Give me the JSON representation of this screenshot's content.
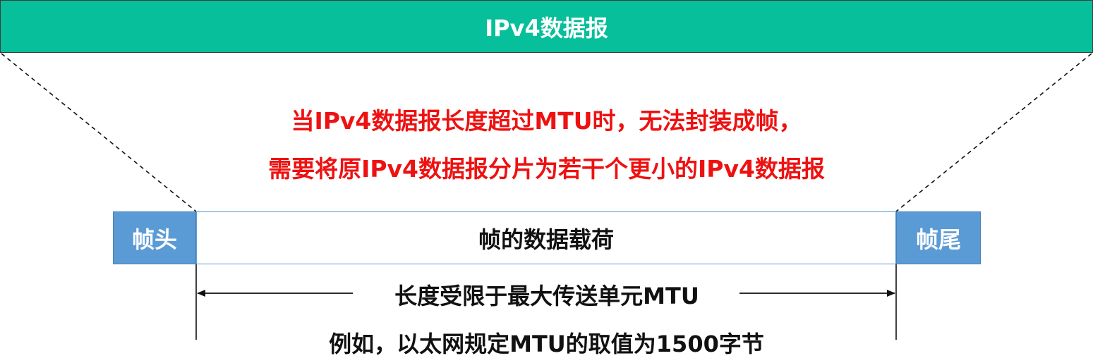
{
  "datagram": {
    "label": "IPv4数据报"
  },
  "warning": {
    "line1": "当IPv4数据报长度超过MTU时，无法封装成帧，",
    "line2": "需要将原IPv4数据报分片为若干个更小的IPv4数据报"
  },
  "frame": {
    "header_label": "帧头",
    "payload_label": "帧的数据载荷",
    "trailer_label": "帧尾"
  },
  "mtu": {
    "limit_label": "长度受限于最大传送单元MTU",
    "example_label": "例如，以太网规定MTU的取值为1500字节"
  },
  "colors": {
    "datagram_fill": "#07bf9a",
    "frame_edge_fill": "#5b9bd5",
    "warning_text": "#ee1111"
  }
}
